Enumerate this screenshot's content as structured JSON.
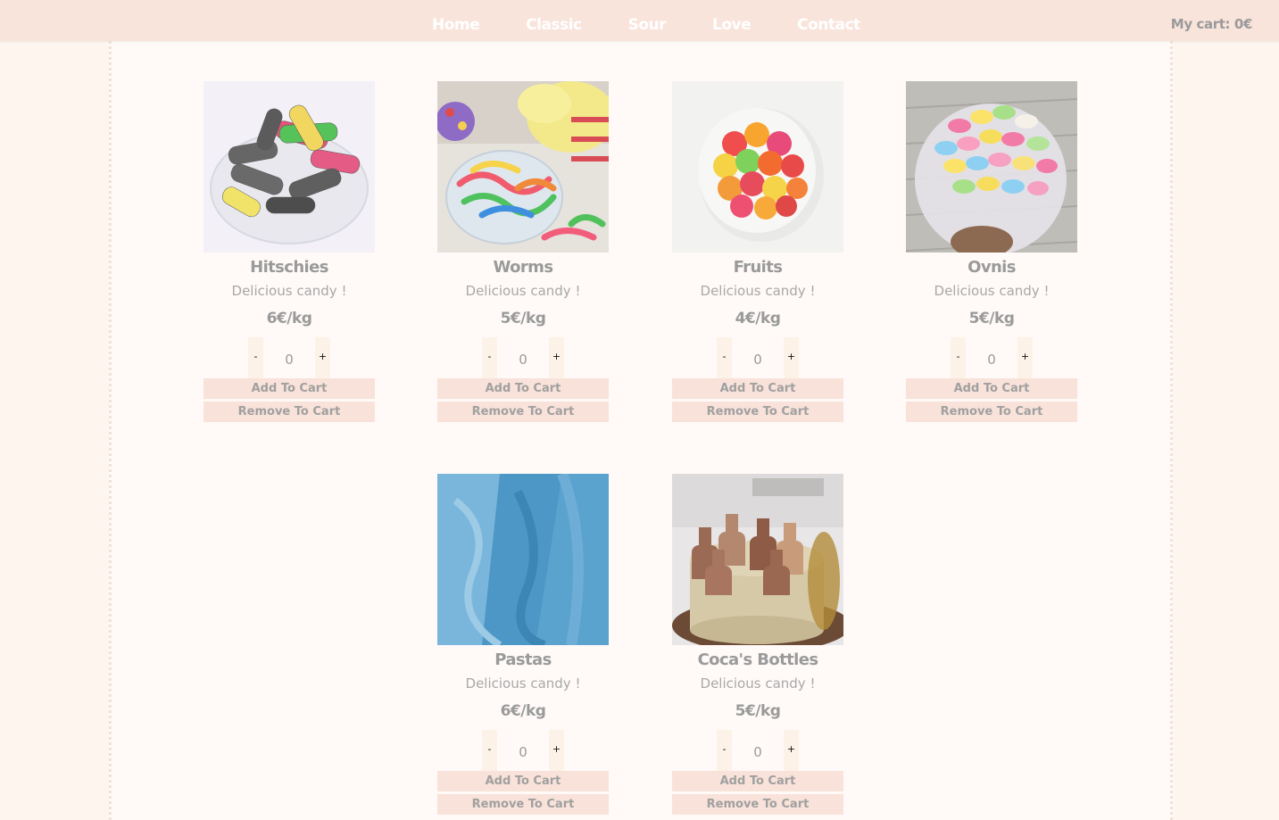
{
  "nav": {
    "links": [
      "Home",
      "Classic",
      "Sour",
      "Love",
      "Contact"
    ],
    "cart_label": "My cart: 0€"
  },
  "labels": {
    "minus": "-",
    "plus": "+",
    "add": "Add To Cart",
    "remove": "Remove To Cart"
  },
  "products": [
    {
      "name": "Hitschies",
      "desc": "Delicious candy !",
      "price": "6€/kg",
      "qty": "0"
    },
    {
      "name": "Worms",
      "desc": "Delicious candy !",
      "price": "5€/kg",
      "qty": "0"
    },
    {
      "name": "Fruits",
      "desc": "Delicious candy !",
      "price": "4€/kg",
      "qty": "0"
    },
    {
      "name": "Ovnis",
      "desc": "Delicious candy !",
      "price": "5€/kg",
      "qty": "0"
    },
    {
      "name": "Pastas",
      "desc": "Delicious candy !",
      "price": "6€/kg",
      "qty": "0"
    },
    {
      "name": "Coca's Bottles",
      "desc": "Delicious candy !",
      "price": "5€/kg",
      "qty": "0"
    }
  ]
}
